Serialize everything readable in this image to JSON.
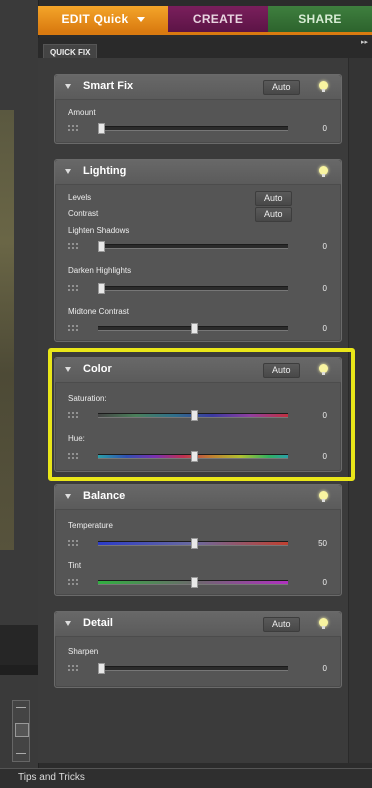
{
  "tabs": {
    "edit": "EDIT Quick",
    "create": "CREATE",
    "share": "SHARE"
  },
  "subtab": {
    "label": "QUICK FIX",
    "collapse_glyph": "▸▸"
  },
  "sections": {
    "smart_fix": {
      "title": "Smart Fix",
      "auto": "Auto",
      "sliders": [
        {
          "label": "Amount",
          "value": "0",
          "level": 0.0
        }
      ]
    },
    "lighting": {
      "title": "Lighting",
      "levels_label": "Levels",
      "levels_auto": "Auto",
      "contrast_label": "Contrast",
      "contrast_auto": "Auto",
      "sliders": [
        {
          "label": "Lighten Shadows",
          "value": "0",
          "level": 0.0
        },
        {
          "label": "Darken Highlights",
          "value": "0",
          "level": 0.0
        },
        {
          "label": "Midtone Contrast",
          "value": "0",
          "level": 0.5
        }
      ]
    },
    "color": {
      "title": "Color",
      "auto": "Auto",
      "sliders": [
        {
          "label": "Saturation:",
          "value": "0",
          "level": 0.5
        },
        {
          "label": "Hue:",
          "value": "0",
          "level": 0.5
        }
      ]
    },
    "balance": {
      "title": "Balance",
      "sliders": [
        {
          "label": "Temperature",
          "value": "50",
          "level": 0.5
        },
        {
          "label": "Tint",
          "value": "0",
          "level": 0.5
        }
      ]
    },
    "detail": {
      "title": "Detail",
      "auto": "Auto",
      "sliders": [
        {
          "label": "Sharpen",
          "value": "0",
          "level": 0.0
        }
      ]
    }
  },
  "footer": {
    "label": "Tips and Tricks"
  },
  "colors": {
    "edit_tab": "#e58c1c",
    "create_tab": "#6a1a50",
    "share_tab": "#357035",
    "highlight": "#e9e619"
  }
}
